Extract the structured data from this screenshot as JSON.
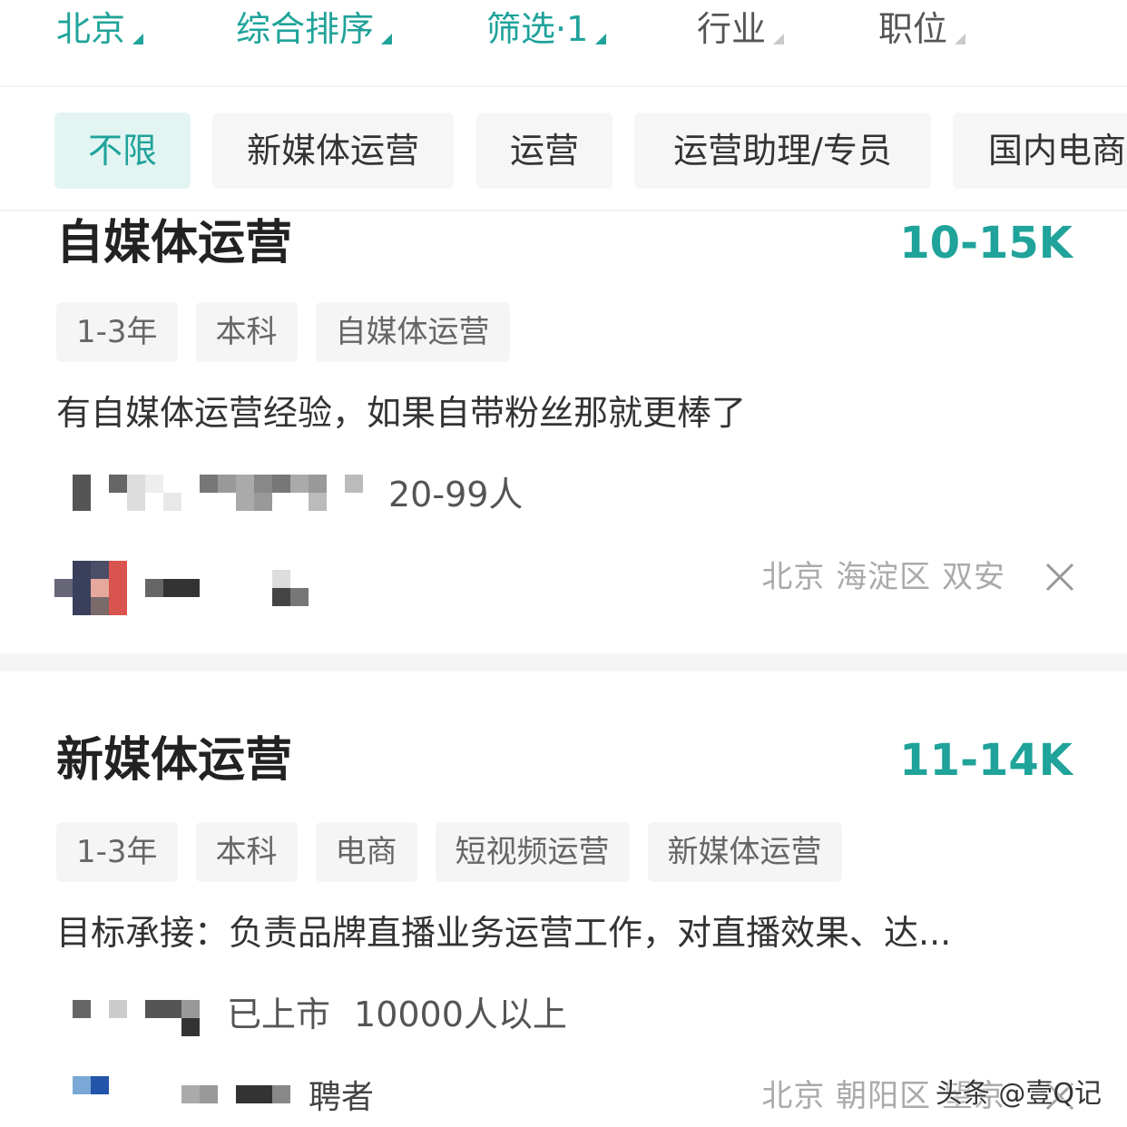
{
  "filters": [
    {
      "label": "北京",
      "active": true
    },
    {
      "label": "综合排序",
      "active": true
    },
    {
      "label": "筛选·1",
      "active": true
    },
    {
      "label": "行业",
      "active": false
    },
    {
      "label": "职位",
      "active": false
    }
  ],
  "categories": [
    "不限",
    "新媒体运营",
    "运营",
    "运营助理/专员",
    "国内电商"
  ],
  "selected_category": "不限",
  "jobs": [
    {
      "title": "自媒体运营",
      "salary": "10-15K",
      "tags": [
        "1-3年",
        "本科",
        "自媒体运营"
      ],
      "description": "有自媒体运营经验，如果自带粉丝那就更棒了",
      "company_meta": "20-99人",
      "location": "北京 海淀区 双安"
    },
    {
      "title": "新媒体运营",
      "salary": "11-14K",
      "tags": [
        "1-3年",
        "本科",
        "电商",
        "短视频运营",
        "新媒体运营"
      ],
      "description": "目标承接：负责品牌直播业务运营工作，对直播效果、达...",
      "company_stage": "已上市",
      "company_meta": "10000人以上",
      "recruiter_suffix": "聘者",
      "location": "北京 朝阳区 望京"
    }
  ],
  "watermark": "头条 @壹Q记",
  "colors": {
    "accent": "#1fa39a",
    "chip_bg": "#f6f6f6",
    "chip_selected_bg": "#e3f5f3"
  },
  "icons": {
    "dropdown": "triangle-icon",
    "dismiss": "close-icon"
  }
}
